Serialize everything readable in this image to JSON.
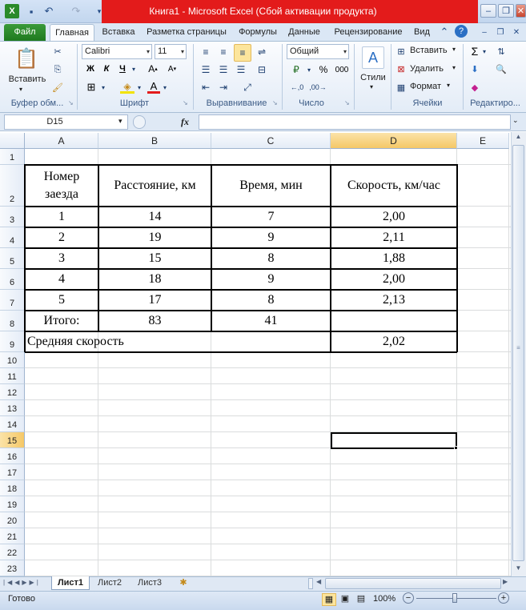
{
  "window": {
    "title": "Книга1  -  Microsoft Excel (Сбой активации продукта)"
  },
  "ribbon": {
    "tabs": [
      "Файл",
      "Главная",
      "Вставка",
      "Разметка страницы",
      "Формулы",
      "Данные",
      "Рецензирование",
      "Вид"
    ],
    "active_tab": "Главная",
    "groups": {
      "clipboard": {
        "label": "Буфер обм...",
        "paste": "Вставить"
      },
      "font": {
        "label": "Шрифт",
        "name": "Calibri",
        "size": "11",
        "bold": "Ж",
        "italic": "К",
        "underline": "Ч"
      },
      "alignment": {
        "label": "Выравнивание"
      },
      "number": {
        "label": "Число",
        "format": "Общий",
        "percent": "%",
        "thousands": "000"
      },
      "styles": {
        "label": "Стили"
      },
      "cells": {
        "label": "Ячейки",
        "insert": "Вставить",
        "delete": "Удалить",
        "format": "Формат"
      },
      "editing": {
        "label": "Редактиро..."
      }
    }
  },
  "formula_bar": {
    "name_box": "D15",
    "fx": "fx",
    "value": ""
  },
  "columns": [
    "A",
    "B",
    "C",
    "D",
    "E"
  ],
  "rows": [
    "1",
    "2",
    "3",
    "4",
    "5",
    "6",
    "7",
    "8",
    "9",
    "10",
    "11",
    "12",
    "13",
    "14",
    "15",
    "16",
    "17",
    "18",
    "19",
    "20",
    "21",
    "22",
    "23"
  ],
  "selected_cell": "D15",
  "table": {
    "headers": [
      "Номер заезда",
      "Расстояние, км",
      "Время, мин",
      "Скорость, км/час"
    ],
    "rows": [
      [
        "1",
        "14",
        "7",
        "2,00"
      ],
      [
        "2",
        "19",
        "9",
        "2,11"
      ],
      [
        "3",
        "15",
        "8",
        "1,88"
      ],
      [
        "4",
        "18",
        "9",
        "2,00"
      ],
      [
        "5",
        "17",
        "8",
        "2,13"
      ]
    ],
    "total": [
      "Итого:",
      "83",
      "41",
      ""
    ],
    "avg_label": "Средняя скорость",
    "avg_value": "2,02"
  },
  "sheets": [
    "Лист1",
    "Лист2",
    "Лист3"
  ],
  "active_sheet": "Лист1",
  "status": {
    "ready": "Готово",
    "zoom": "100%"
  },
  "colors": {
    "accent_red": "#e31b1b",
    "file_green": "#2a8a2a",
    "selection": "#f5c867"
  }
}
